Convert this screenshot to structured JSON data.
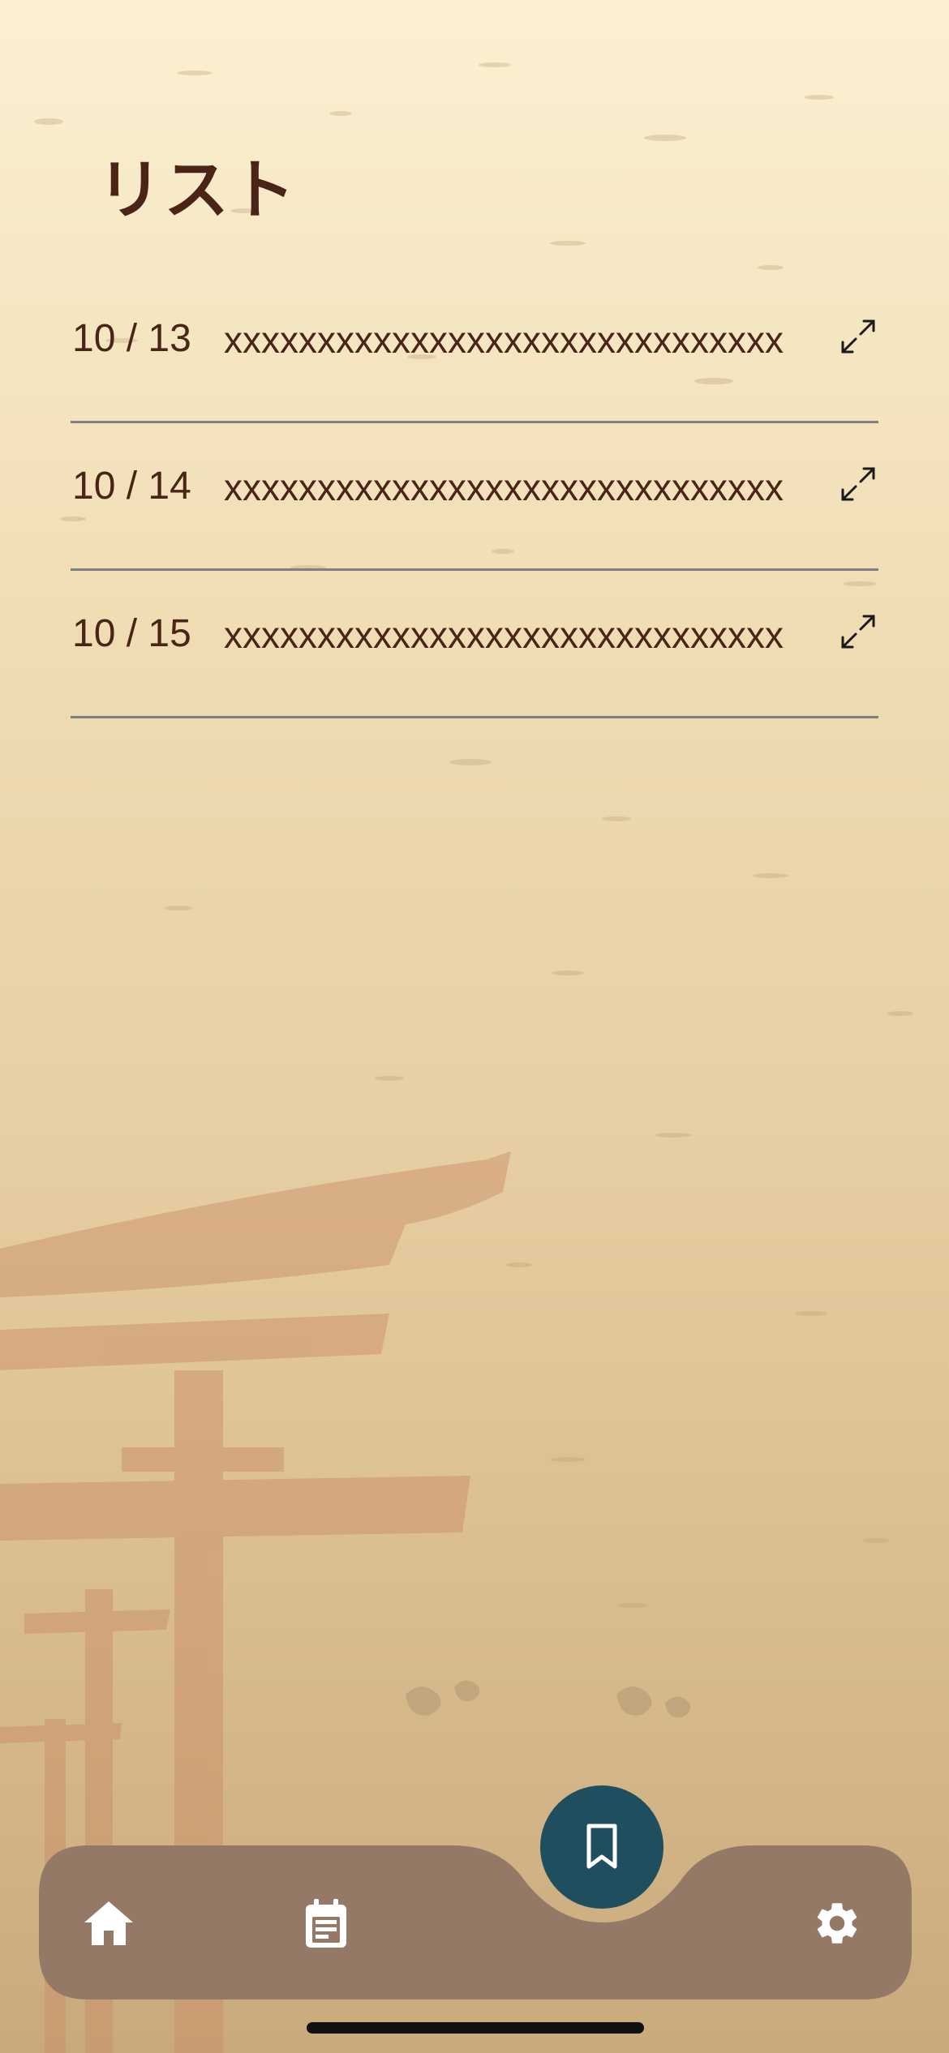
{
  "page": {
    "title": "リスト"
  },
  "list": {
    "items": [
      {
        "date": "10 / 13",
        "text": "xxxxxxxxxxxxxxxxxxxxxxxxxxxxxx"
      },
      {
        "date": "10 / 14",
        "text": "xxxxxxxxxxxxxxxxxxxxxxxxxxxxxx"
      },
      {
        "date": "10 / 15",
        "text": "xxxxxxxxxxxxxxxxxxxxxxxxxxxxxx"
      }
    ]
  },
  "nav": {
    "items": [
      {
        "icon": "home-icon"
      },
      {
        "icon": "calendar-note-icon"
      },
      {
        "icon": "bookmark-icon",
        "active": true
      },
      {
        "icon": "gear-icon"
      }
    ]
  },
  "colors": {
    "title_text": "#4a2417",
    "divider": "#7e7f81",
    "nav_bar": "#937966",
    "fab": "#1f4e5f",
    "nav_icon": "#ffffff"
  }
}
